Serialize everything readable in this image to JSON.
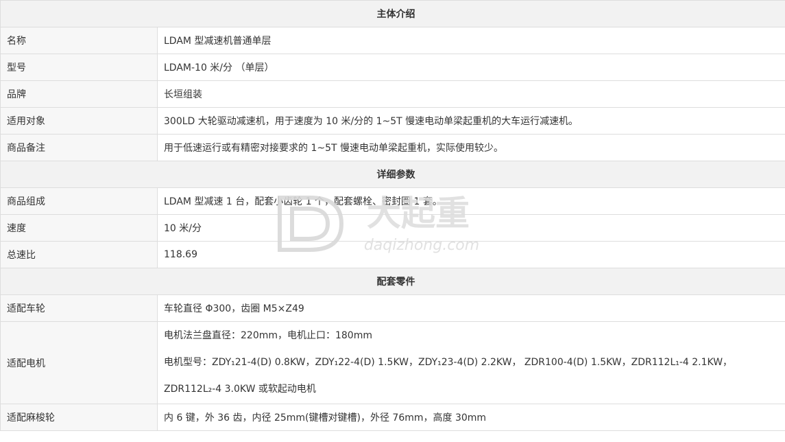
{
  "sections": [
    {
      "title": "主体介绍",
      "rows": [
        {
          "label": "名称",
          "value": "LDAM 型减速机普通单层"
        },
        {
          "label": "型号",
          "value": "LDAM-10 米/分  （单层）"
        },
        {
          "label": "品牌",
          "value": "长垣组装"
        },
        {
          "label": "适用对象",
          "value": "300LD 大轮驱动减速机，用于速度为 10 米/分的 1~5T 慢速电动单梁起重机的大车运行减速机。"
        },
        {
          "label": "商品备注",
          "value": "用于低速运行或有精密对接要求的 1~5T 慢速电动单梁起重机，实际使用较少。"
        }
      ]
    },
    {
      "title": "详细参数",
      "rows": [
        {
          "label": "商品组成",
          "value": "LDAM 型减速 1 台，配套小齿轮 1 个，配套螺栓、密封圈 1 套。"
        },
        {
          "label": "速度",
          "value": "10 米/分"
        },
        {
          "label": "总速比",
          "value": "118.69"
        }
      ]
    },
    {
      "title": "配套零件",
      "rows": [
        {
          "label": "适配车轮",
          "value": "车轮直径 Φ300，齿圈 M5×Z49"
        },
        {
          "label": "适配电机",
          "lines": [
            "电机法兰盘直径：220mm，电机止口：180mm",
            "电机型号：ZDY₁21-4(D)    0.8KW，ZDY₁22-4(D)    1.5KW，ZDY₁23-4(D)    2.2KW，  ZDR100-4(D)    1.5KW，ZDR112L₁-4    2.1KW，",
            "ZDR112L₂-4    3.0KW 或软起动电机"
          ]
        },
        {
          "label": "适配麻梭轮",
          "value": "内 6 键，外 36 齿，内径 25mm(键槽对键槽)，外径 76mm，高度 30mm"
        }
      ]
    }
  ],
  "watermark": {
    "logo_text": "大起重",
    "url_text": "daqizhong.com",
    "color": "#dcdcdc"
  }
}
